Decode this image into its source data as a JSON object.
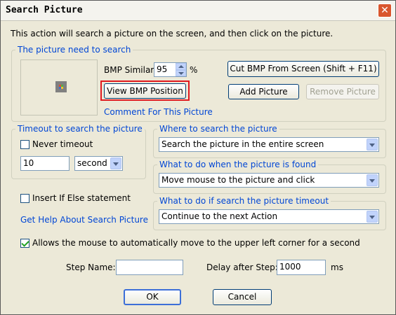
{
  "window": {
    "title": "Search Picture",
    "close_label": "✕"
  },
  "description": "This action will search a picture on the screen, and then click on the picture.",
  "picture_group": {
    "legend": "The picture need to search",
    "bmp_similar_label": "BMP Similar:",
    "bmp_similar_value": "95",
    "percent": "%",
    "view_bmp_position": "View BMP Position",
    "comment_link": "Comment For This Picture",
    "cut_bmp": "Cut BMP From Screen (Shift + F11)",
    "add_picture": "Add Picture",
    "remove_picture": "Remove Picture"
  },
  "timeout_group": {
    "legend": "Timeout to search the picture",
    "never_timeout": "Never timeout",
    "never_timeout_checked": false,
    "value": "10",
    "unit": "second"
  },
  "where_group": {
    "legend": "Where to search the picture",
    "selected": "Search the picture in the entire screen"
  },
  "found_group": {
    "legend": "What to do when the picture is found",
    "selected": "Move mouse to the picture and click"
  },
  "timeout_action_group": {
    "legend": "What to do if search the picture timeout",
    "selected": "Continue to the next Action"
  },
  "insert_if_else": {
    "label": "Insert If Else statement",
    "checked": false
  },
  "help_link": "Get Help About Search Picture",
  "auto_move": {
    "label": "Allows the mouse to automatically move to the upper left corner for a second",
    "checked": true
  },
  "step_name": {
    "label": "Step Name:",
    "value": ""
  },
  "delay": {
    "label": "Delay after Step:",
    "value": "1000",
    "unit": "ms"
  },
  "buttons": {
    "ok": "OK",
    "cancel": "Cancel"
  },
  "colors": {
    "title_close": "#d9562e",
    "legend_text": "#0046d5",
    "highlight_border": "#e0191e"
  }
}
